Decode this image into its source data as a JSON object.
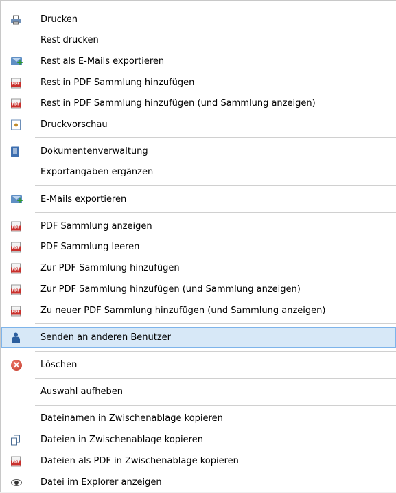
{
  "menu": {
    "items": [
      {
        "label": "Drucken",
        "icon": "printer-icon"
      },
      {
        "label": "Rest drucken",
        "icon": null
      },
      {
        "label": "Rest als E-Mails exportieren",
        "icon": "mail-export-icon"
      },
      {
        "label": "Rest in PDF Sammlung hinzufügen",
        "icon": "pdf-icon"
      },
      {
        "label": "Rest in PDF Sammlung hinzufügen (und Sammlung anzeigen)",
        "icon": "pdf-icon"
      },
      {
        "label": "Druckvorschau",
        "icon": "print-preview-icon"
      },
      {
        "label": "Dokumentenverwaltung",
        "icon": "document-management-icon"
      },
      {
        "label": "Exportangaben ergänzen",
        "icon": null
      },
      {
        "label": "E-Mails exportieren",
        "icon": "mail-export-icon"
      },
      {
        "label": "PDF Sammlung anzeigen",
        "icon": "pdf-icon"
      },
      {
        "label": "PDF Sammlung leeren",
        "icon": "pdf-icon"
      },
      {
        "label": "Zur PDF Sammlung hinzufügen",
        "icon": "pdf-icon"
      },
      {
        "label": "Zur PDF Sammlung hinzufügen (und Sammlung anzeigen)",
        "icon": "pdf-icon"
      },
      {
        "label": "Zu neuer PDF Sammlung hinzufügen (und Sammlung anzeigen)",
        "icon": "pdf-icon"
      },
      {
        "label": "Senden an anderen Benutzer",
        "icon": "user-icon",
        "highlighted": true
      },
      {
        "label": "Löschen",
        "icon": "delete-icon"
      },
      {
        "label": "Auswahl aufheben",
        "icon": null
      },
      {
        "label": "Dateinamen in Zwischenablage kopieren",
        "icon": null
      },
      {
        "label": "Dateien in Zwischenablage kopieren",
        "icon": "copy-icon"
      },
      {
        "label": "Dateien als PDF in Zwischenablage kopieren",
        "icon": "pdf-icon"
      },
      {
        "label": "Datei im Explorer anzeigen",
        "icon": "eye-icon"
      }
    ]
  },
  "colors": {
    "highlight_bg": "#d7e8f7",
    "highlight_border": "#7eb4ea",
    "separator": "#d0d0d0"
  }
}
